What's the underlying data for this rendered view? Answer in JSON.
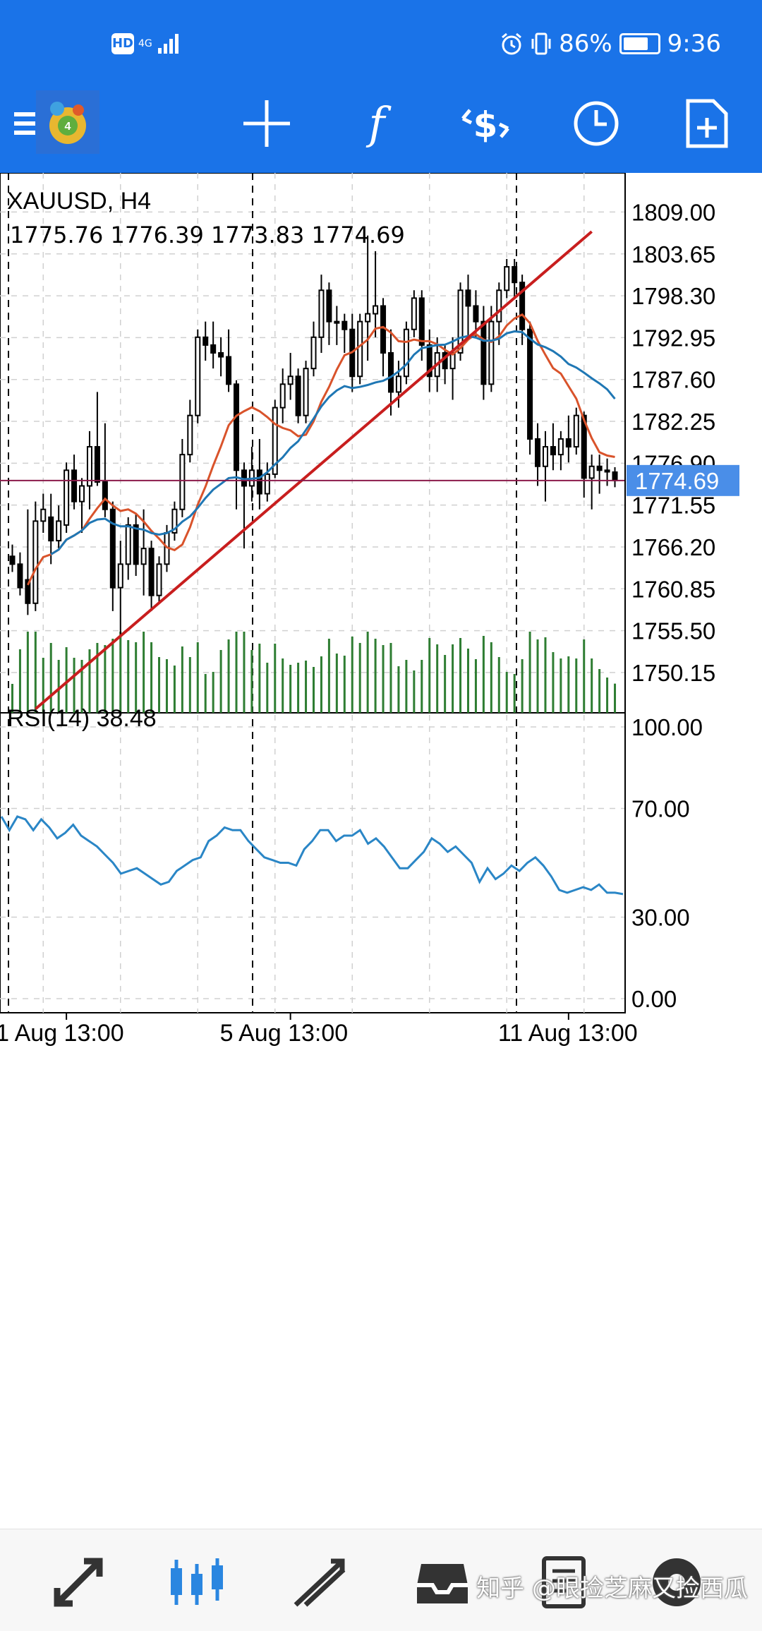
{
  "status_bar": {
    "time": "9:36",
    "battery": "86%",
    "network": "4G",
    "hd": "HD",
    "battery_level": 0.86
  },
  "toolbar": {
    "icons": [
      "menu-icon",
      "metatrader-logo",
      "crosshair-icon",
      "function-icon",
      "trade-icon",
      "history-clock-icon",
      "new-document-icon"
    ]
  },
  "chart_data": [
    {
      "type": "candlestick",
      "title": "XAUUSD, H4",
      "ohlc_readout": [
        "1775.76",
        "1776.39",
        "1773.83",
        "1774.69"
      ],
      "y_ticks": [
        "1809.00",
        "1803.65",
        "1798.30",
        "1792.95",
        "1787.60",
        "1782.25",
        "1776.90",
        "1771.55",
        "1766.20",
        "1760.85",
        "1755.50",
        "1750.15"
      ],
      "x_ticks": [
        "1 Aug 13:00",
        "5 Aug 13:00",
        "11 Aug 13:00"
      ],
      "current_price": "1774.69",
      "ylim": [
        1745,
        1814
      ],
      "n_bars": 60,
      "candles": [
        [
          1765.0,
          1766.5,
          1763.0,
          1764.0
        ],
        [
          1764.0,
          1765.5,
          1760.0,
          1761.0
        ],
        [
          1762.0,
          1771.0,
          1757.5,
          1759.0
        ],
        [
          1759.0,
          1772.0,
          1758.0,
          1769.5
        ],
        [
          1769.5,
          1773.0,
          1768.0,
          1771.0
        ],
        [
          1770.0,
          1773.0,
          1764.0,
          1767.0
        ],
        [
          1767.0,
          1771.5,
          1766.0,
          1769.5
        ],
        [
          1769.0,
          1777.0,
          1768.0,
          1776.0
        ],
        [
          1776.0,
          1778.0,
          1771.0,
          1772.0
        ],
        [
          1772.0,
          1775.0,
          1768.0,
          1774.0
        ],
        [
          1774.0,
          1781.0,
          1771.0,
          1779.0
        ],
        [
          1779.0,
          1786.0,
          1774.0,
          1774.5
        ],
        [
          1774.5,
          1782.0,
          1770.0,
          1771.0
        ],
        [
          1771.0,
          1772.0,
          1758.0,
          1761.0
        ],
        [
          1761.0,
          1767.0,
          1755.0,
          1764.0
        ],
        [
          1764.0,
          1770.0,
          1762.0,
          1769.0
        ],
        [
          1769.0,
          1770.5,
          1762.5,
          1764.0
        ],
        [
          1764.0,
          1771.0,
          1760.0,
          1766.0
        ],
        [
          1766.0,
          1767.0,
          1758.0,
          1760.0
        ],
        [
          1760.0,
          1765.0,
          1759.0,
          1764.0
        ],
        [
          1764.0,
          1769.0,
          1763.0,
          1768.0
        ],
        [
          1768.0,
          1772.0,
          1767.0,
          1771.0
        ],
        [
          1771.0,
          1780.0,
          1770.0,
          1778.0
        ],
        [
          1778.0,
          1785.0,
          1777.0,
          1783.0
        ],
        [
          1783.0,
          1794.0,
          1782.0,
          1793.0
        ],
        [
          1793.0,
          1795.0,
          1790.0,
          1792.0
        ],
        [
          1792.0,
          1795.0,
          1789.0,
          1791.0
        ],
        [
          1791.0,
          1793.0,
          1788.0,
          1790.5
        ],
        [
          1790.5,
          1794.0,
          1786.0,
          1787.0
        ],
        [
          1787.0,
          1787.5,
          1771.0,
          1776.0
        ],
        [
          1776.0,
          1777.0,
          1766.0,
          1774.0
        ],
        [
          1774.0,
          1779.0,
          1772.0,
          1776.0
        ],
        [
          1776.0,
          1780.0,
          1771.0,
          1773.0
        ],
        [
          1773.0,
          1777.0,
          1772.0,
          1775.5
        ],
        [
          1775.5,
          1785.0,
          1775.0,
          1784.0
        ],
        [
          1784.0,
          1789.0,
          1782.0,
          1787.0
        ],
        [
          1787.0,
          1791.0,
          1785.0,
          1788.0
        ],
        [
          1788.0,
          1789.0,
          1782.0,
          1783.0
        ],
        [
          1783.0,
          1790.0,
          1782.0,
          1789.0
        ],
        [
          1789.0,
          1795.0,
          1788.0,
          1793.0
        ],
        [
          1793.0,
          1801.0,
          1791.0,
          1799.0
        ],
        [
          1799.0,
          1800.0,
          1792.0,
          1795.0
        ],
        [
          1795.0,
          1797.0,
          1792.0,
          1795.0
        ],
        [
          1795.0,
          1796.0,
          1791.0,
          1794.0
        ],
        [
          1794.0,
          1796.0,
          1786.0,
          1788.0
        ],
        [
          1788.0,
          1796.0,
          1787.0,
          1795.0
        ],
        [
          1795.0,
          1806.0,
          1790.0,
          1796.0
        ],
        [
          1796.0,
          1804.0,
          1793.0,
          1797.0
        ],
        [
          1797.0,
          1798.0,
          1788.0,
          1791.0
        ],
        [
          1791.0,
          1794.0,
          1783.0,
          1786.0
        ],
        [
          1786.0,
          1790.0,
          1784.0,
          1788.0
        ],
        [
          1788.0,
          1795.0,
          1787.0,
          1794.0
        ],
        [
          1794.0,
          1799.0,
          1793.0,
          1798.0
        ],
        [
          1798.0,
          1799.0,
          1790.0,
          1792.0
        ],
        [
          1792.0,
          1794.0,
          1786.0,
          1788.0
        ],
        [
          1788.0,
          1793.0,
          1786.0,
          1791.0
        ],
        [
          1791.0,
          1792.0,
          1787.0,
          1789.0
        ],
        [
          1789.0,
          1793.0,
          1785.0,
          1791.0
        ],
        [
          1791.0,
          1800.0,
          1790.0,
          1799.0
        ],
        [
          1799.0,
          1801.0,
          1793.0,
          1797.0
        ],
        [
          1797.0,
          1799.0,
          1793.0,
          1795.0
        ],
        [
          1795.0,
          1797.0,
          1785.0,
          1787.0
        ],
        [
          1787.0,
          1797.0,
          1786.0,
          1795.0
        ],
        [
          1795.0,
          1800.0,
          1792.0,
          1799.0
        ],
        [
          1799.0,
          1803.0,
          1798.0,
          1802.0
        ],
        [
          1802.0,
          1803.0,
          1798.0,
          1800.0
        ],
        [
          1800.0,
          1801.0,
          1792.0,
          1794.0
        ],
        [
          1794.0,
          1795.0,
          1778.0,
          1780.0
        ],
        [
          1780.0,
          1782.0,
          1774.0,
          1776.5
        ],
        [
          1776.5,
          1781.0,
          1772.0,
          1779.0
        ],
        [
          1779.0,
          1782.0,
          1776.0,
          1778.0
        ],
        [
          1778.0,
          1781.0,
          1776.0,
          1780.0
        ],
        [
          1780.0,
          1783.0,
          1777.0,
          1779.0
        ],
        [
          1779.0,
          1784.0,
          1778.0,
          1783.0
        ],
        [
          1783.0,
          1783.5,
          1772.5,
          1775.0
        ],
        [
          1775.0,
          1778.0,
          1771.0,
          1776.5
        ],
        [
          1776.5,
          1778.0,
          1773.0,
          1776.0
        ],
        [
          1776.0,
          1777.5,
          1774.0,
          1775.8
        ],
        [
          1775.76,
          1776.39,
          1773.83,
          1774.69
        ]
      ],
      "volume_colors": {
        "candle": "#000000",
        "volume": "#2e7d32",
        "ma_fast": "#d9532b",
        "ma_slow": "#1f77b4",
        "trendline": "#c81e1e",
        "price_line": "#8b1a4a",
        "price_tag": "#4a8ee8",
        "grid": "#d0d0d0"
      }
    },
    {
      "type": "line",
      "title": "RSI(14) 38.48",
      "y_ticks": [
        "100.00",
        "70.00",
        "30.00",
        "0.00"
      ],
      "ylim": [
        0,
        100
      ],
      "rsi": [
        67,
        62,
        67,
        66,
        62,
        66,
        63,
        59,
        61,
        64,
        60,
        58,
        56,
        53,
        50,
        46,
        47,
        48,
        46,
        44,
        42,
        43,
        47,
        49,
        51,
        52,
        58,
        60,
        63,
        62,
        62,
        58,
        55,
        52,
        51,
        50,
        50,
        49,
        55,
        58,
        62,
        62,
        58,
        60,
        60,
        62,
        57,
        59,
        56,
        52,
        48,
        48,
        51,
        54,
        59,
        57,
        54,
        56,
        53,
        50,
        43,
        48,
        44,
        46,
        49,
        47,
        50,
        52,
        49,
        45,
        40,
        39,
        40,
        41,
        40,
        42,
        39,
        39,
        38.48
      ]
    }
  ],
  "bottom_nav": {
    "icons": [
      "quotes-icon",
      "chart-icon",
      "trade-icon",
      "inbox-icon",
      "news-icon",
      "settings-icon"
    ],
    "watermark": "知乎 @眼捡芝麻又捡西瓜"
  }
}
